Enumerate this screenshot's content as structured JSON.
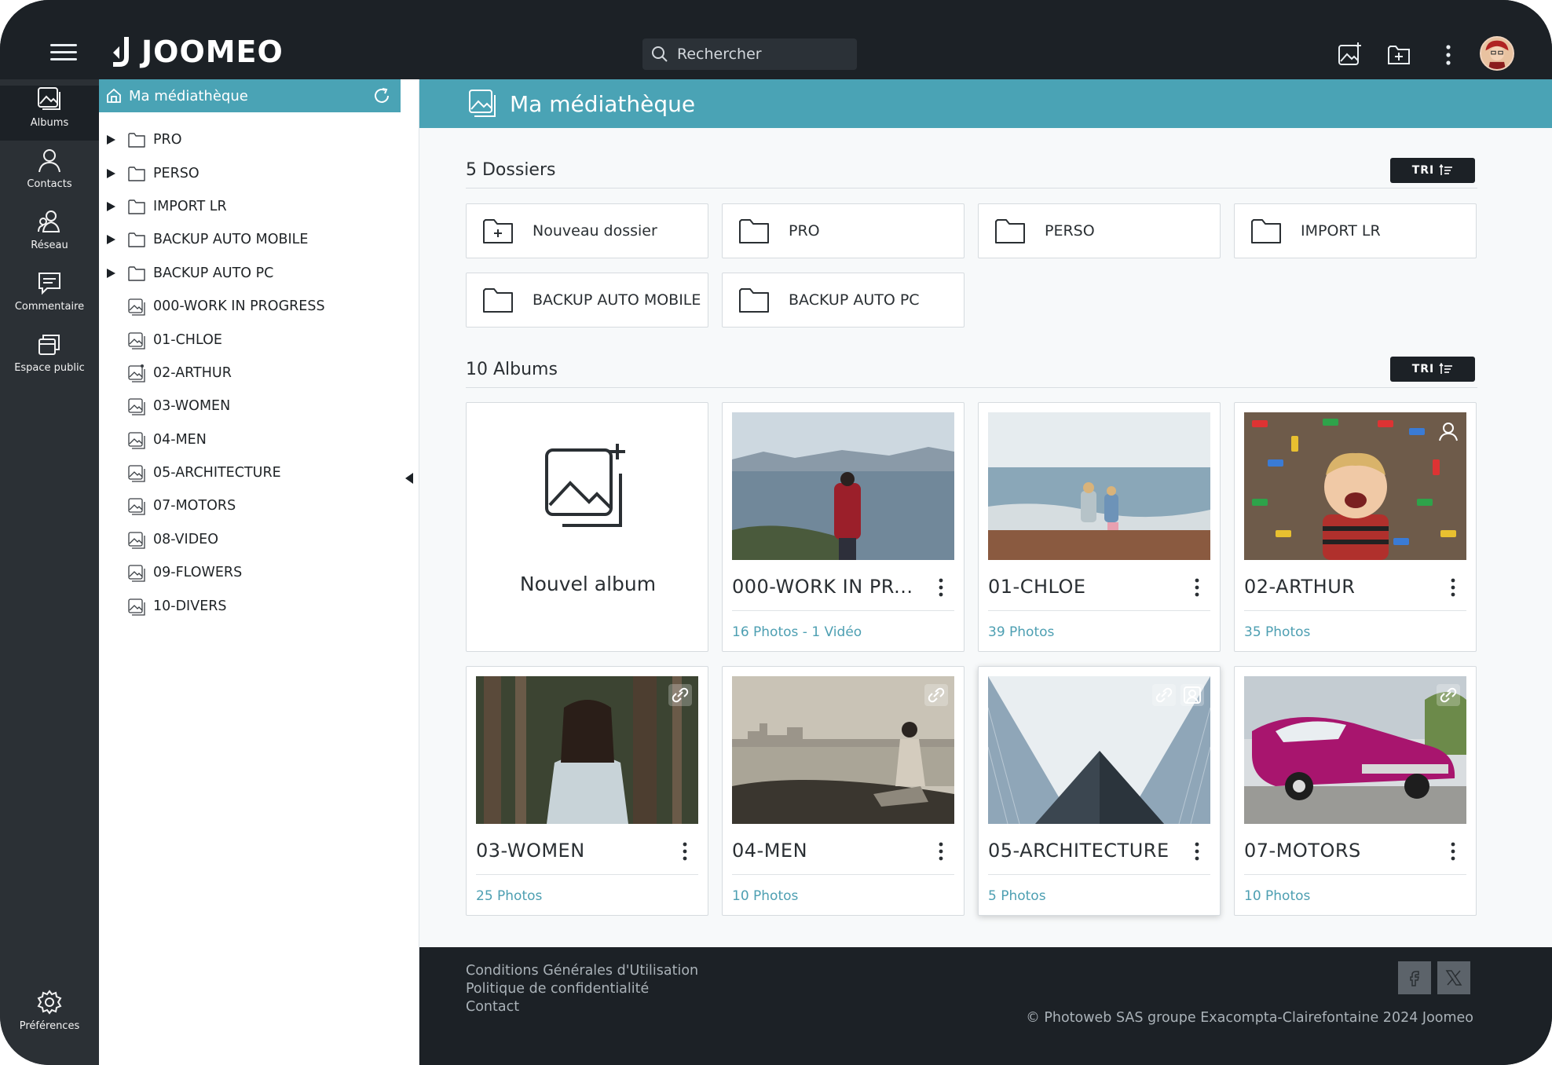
{
  "app": {
    "name": "JOOMEO"
  },
  "search": {
    "placeholder": "Rechercher"
  },
  "topbar": {
    "icons": [
      "add-album-icon",
      "add-folder-icon",
      "more-vertical-icon",
      "avatar"
    ]
  },
  "rail": {
    "items": [
      {
        "label": "Albums",
        "icon": "albums-icon",
        "active": true
      },
      {
        "label": "Contacts",
        "icon": "contacts-icon"
      },
      {
        "label": "Réseau",
        "icon": "network-icon"
      },
      {
        "label": "Commentaire",
        "icon": "comment-icon"
      },
      {
        "label": "Espace public",
        "icon": "public-space-icon"
      }
    ],
    "preferences": {
      "label": "Préférences",
      "icon": "gear-icon"
    }
  },
  "tree": {
    "header": "Ma médiathèque",
    "items": [
      {
        "label": "PRO",
        "type": "folder"
      },
      {
        "label": "PERSO",
        "type": "folder"
      },
      {
        "label": "IMPORT LR",
        "type": "folder"
      },
      {
        "label": "BACKUP AUTO MOBILE",
        "type": "folder"
      },
      {
        "label": "BACKUP AUTO PC",
        "type": "folder"
      },
      {
        "label": "000-WORK IN PROGRESS",
        "type": "album"
      },
      {
        "label": "01-CHLOE",
        "type": "album"
      },
      {
        "label": "02-ARTHUR",
        "type": "album-shared"
      },
      {
        "label": "03-WOMEN",
        "type": "album"
      },
      {
        "label": "04-MEN",
        "type": "album"
      },
      {
        "label": "05-ARCHITECTURE",
        "type": "album"
      },
      {
        "label": "07-MOTORS",
        "type": "album"
      },
      {
        "label": "08-VIDEO",
        "type": "album"
      },
      {
        "label": "09-FLOWERS",
        "type": "album"
      },
      {
        "label": "10-DIVERS",
        "type": "album"
      }
    ]
  },
  "main": {
    "title": "Ma médiathèque",
    "folders_section": {
      "title": "5 Dossiers",
      "sort_label": "TRI"
    },
    "folders": [
      {
        "label": "Nouveau dossier",
        "icon": "new-folder-icon"
      },
      {
        "label": "PRO",
        "icon": "folder-icon"
      },
      {
        "label": "PERSO",
        "icon": "folder-icon"
      },
      {
        "label": "IMPORT LR",
        "icon": "folder-icon"
      },
      {
        "label": "BACKUP AUTO MOBILE",
        "icon": "folder-icon"
      },
      {
        "label": "BACKUP AUTO PC",
        "icon": "folder-icon"
      }
    ],
    "albums_section": {
      "title": "10 Albums",
      "sort_label": "TRI"
    },
    "new_album": {
      "label": "Nouvel album"
    },
    "albums": [
      {
        "name": "000-WORK IN PR...",
        "count": "16 Photos - 1 Vidéo",
        "badges": []
      },
      {
        "name": "01-CHLOE",
        "count": "39 Photos",
        "badges": []
      },
      {
        "name": "02-ARTHUR",
        "count": "35 Photos",
        "badges": [
          "contact-icon"
        ]
      },
      {
        "name": "03-WOMEN",
        "count": "25 Photos",
        "badges": [
          "link-icon"
        ]
      },
      {
        "name": "04-MEN",
        "count": "10 Photos",
        "badges": [
          "link-icon"
        ]
      },
      {
        "name": "05-ARCHITECTURE",
        "count": "5 Photos",
        "badges": [
          "link-icon",
          "contact-icon"
        ]
      },
      {
        "name": "07-MOTORS",
        "count": "10 Photos",
        "badges": [
          "link-icon"
        ]
      }
    ]
  },
  "footer": {
    "links": [
      "Conditions Générales d'Utilisation",
      "Politique de confidentialité",
      "Contact"
    ],
    "social": [
      "facebook-icon",
      "x-icon"
    ],
    "copyright": "© Photoweb SAS groupe Exacompta-Clairefontaine 2024 Joomeo"
  },
  "colors": {
    "accent": "#4aa3b5",
    "dark": "#1c2126",
    "rail": "#2b3035",
    "count_text": "#4d9fb2"
  }
}
